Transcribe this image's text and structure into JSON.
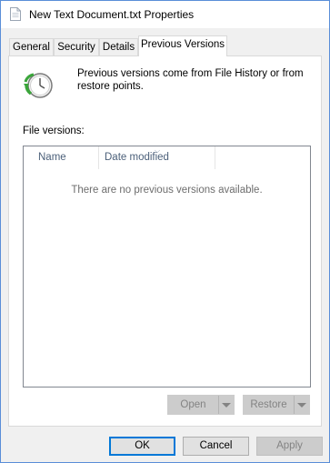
{
  "window": {
    "title": "New Text Document.txt Properties",
    "icon": "text-file-icon"
  },
  "tabs": [
    {
      "label": "General"
    },
    {
      "label": "Security"
    },
    {
      "label": "Details"
    },
    {
      "label": "Previous Versions",
      "active": true
    }
  ],
  "panel": {
    "icon": "file-history-icon",
    "description": "Previous versions come from File History or from restore points.",
    "file_versions_label": "File versions:",
    "columns": [
      {
        "label": "Name"
      },
      {
        "label": "Date modified"
      }
    ],
    "empty_message": "There are no previous versions available.",
    "open_button": "Open",
    "restore_button": "Restore"
  },
  "buttons": {
    "ok": "OK",
    "cancel": "Cancel",
    "apply": "Apply"
  },
  "colors": {
    "accent": "#0078d7",
    "window_border": "#5a8ed8",
    "icon_green": "#3aa53a"
  }
}
